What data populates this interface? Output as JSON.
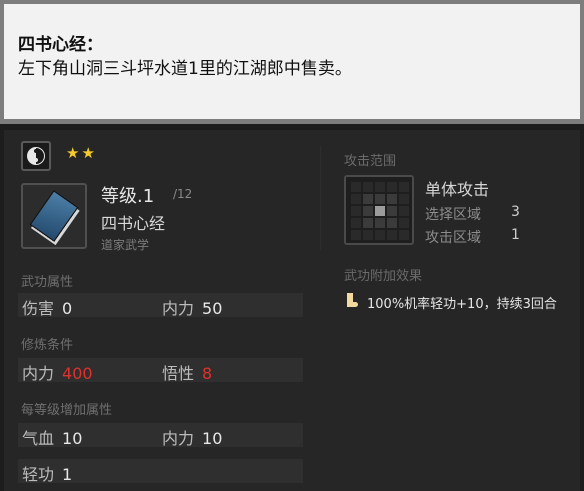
{
  "tooltip": {
    "title": "四书心经：",
    "description": "左下角山洞三斗坪水道1里的江湖郎中售卖。"
  },
  "header": {
    "type_icon": "yin-yang-icon",
    "stars": "★★",
    "star_color": "#f5cc2a"
  },
  "skill": {
    "icon": "book-icon",
    "level": "等级.1",
    "level_max": "/12",
    "name": "四书心经",
    "school": "道家武学"
  },
  "attributes": {
    "title": "武功属性",
    "row1": {
      "k1": "伤害",
      "v1": "0",
      "k2": "内力",
      "v2": "50"
    }
  },
  "requirements": {
    "title": "修炼条件",
    "row1": {
      "k1": "内力",
      "v1": "400",
      "k2": "悟性",
      "v2": "8"
    },
    "unmet_color": "#e0312c"
  },
  "per_level": {
    "title": "每等级增加属性",
    "row1": {
      "k1": "气血",
      "v1": "10",
      "k2": "内力",
      "v2": "10"
    },
    "row2": {
      "k1": "轻功",
      "v1": "1"
    }
  },
  "attack_range": {
    "title": "攻击范围",
    "type": "单体攻击",
    "select_label": "选择区域",
    "select_value": "3",
    "attack_label": "攻击区域",
    "attack_value": "1"
  },
  "extra_effect": {
    "title": "武功附加效果",
    "icon": "boot-icon",
    "text": "100%机率轻功+10，持续3回合"
  }
}
